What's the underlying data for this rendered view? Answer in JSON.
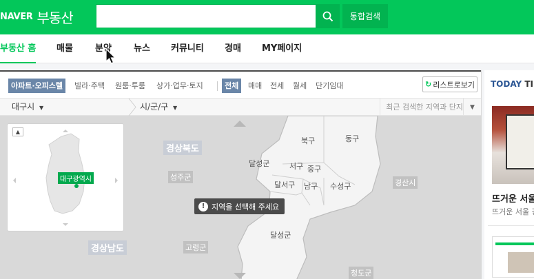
{
  "header": {
    "logo_naver": "NAVER",
    "logo_title": "부동산",
    "search_value": "",
    "search_placeholder": "",
    "search_icon": "search-icon",
    "unified_search_label": "통합검색",
    "brand_color": "#03c75a"
  },
  "nav": {
    "items": [
      {
        "label": "부동산 홈",
        "active": true
      },
      {
        "label": "매물"
      },
      {
        "label": "분양"
      },
      {
        "label": "뉴스"
      },
      {
        "label": "커뮤니티"
      },
      {
        "label": "경매"
      },
      {
        "label": "MY페이지"
      }
    ]
  },
  "filters": {
    "property_types": [
      "아파트·오피스텔",
      "빌라·주택",
      "원룸·투룸",
      "상가·업무·토지"
    ],
    "selected_property_type": "아파트·오피스텔",
    "trade_types": [
      "전체",
      "매매",
      "전세",
      "월세",
      "단기임대"
    ],
    "selected_trade_type": "전체",
    "list_view_label": "리스트로보기",
    "list_view_icon": "refresh-icon"
  },
  "region": {
    "city": "대구시",
    "district": "시/군/구",
    "recent_label": "최근 검색한 지역과 단지"
  },
  "map": {
    "minimap_badge": "대구광역시",
    "tooltip": "지역을 선택해 주세요",
    "province_labels": [
      "경상북도",
      "경상남도"
    ],
    "county_labels": [
      "성주군",
      "고령군",
      "경산시",
      "청도군"
    ],
    "district_labels": [
      "북구",
      "동구",
      "달성군",
      "서구",
      "중구",
      "달서구",
      "남구",
      "수성구",
      "달성군"
    ]
  },
  "today": {
    "label_today": "TODAY",
    "label_tip": "TIP",
    "title": "뜨거운 서울",
    "desc": "뜨거운 서울 강"
  }
}
